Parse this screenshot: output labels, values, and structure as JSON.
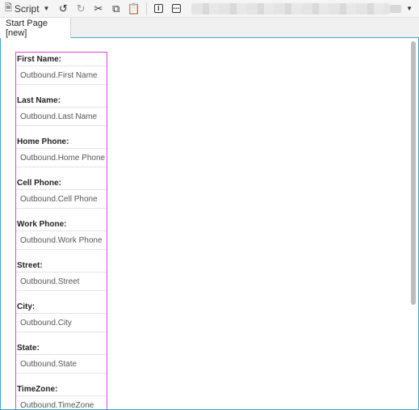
{
  "toolbar": {
    "script_label": "Script",
    "icons": [
      "document-icon",
      "undo-icon",
      "redo-icon",
      "cut-icon",
      "copy-icon",
      "paste-icon",
      "info-box-icon",
      "ellipsis-box-icon"
    ]
  },
  "tabs": [
    {
      "label": "Start Page [new]",
      "active": true
    }
  ],
  "form": {
    "fields": [
      {
        "label": "First Name:",
        "value": "Outbound.First Name"
      },
      {
        "label": "Last Name:",
        "value": "Outbound.Last Name"
      },
      {
        "label": "Home Phone:",
        "value": "Outbound.Home Phone"
      },
      {
        "label": "Cell Phone:",
        "value": "Outbound.Cell Phone"
      },
      {
        "label": "Work Phone:",
        "value": "Outbound.Work Phone"
      },
      {
        "label": "Street:",
        "value": "Outbound.Street"
      },
      {
        "label": "City:",
        "value": "Outbound.City"
      },
      {
        "label": "State:",
        "value": "Outbound.State"
      },
      {
        "label": "TimeZone:",
        "value": "Outbound.TimeZone"
      }
    ]
  },
  "colors": {
    "accent": "#39a7c8",
    "selection_outline": "#e040e0"
  }
}
